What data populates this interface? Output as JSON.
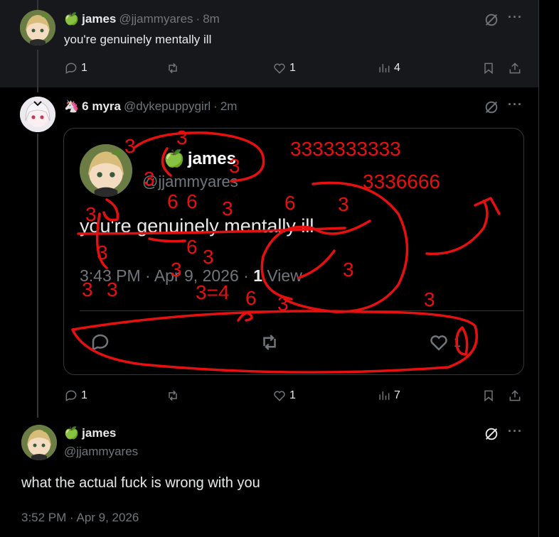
{
  "tweets": [
    {
      "emoji": "🍏",
      "name": "james",
      "handle": "@jjammyares",
      "sep": "·",
      "time": "8m",
      "text": "you're genuinely mentally ill",
      "replies": "1",
      "likes": "1",
      "views": "4"
    },
    {
      "emoji": "🦄",
      "name": "6 myra",
      "handle": "@dykepuppygirl",
      "sep": "·",
      "time": "2m",
      "replies": "1",
      "likes": "1",
      "views": "7",
      "image": {
        "emoji": "🍏",
        "name": "james",
        "handle": "@jjammyares",
        "text": "you're genuinely mentally ill",
        "meta_prefix": "3:43 PM · Apr 9, 2026 · ",
        "meta_views": "1",
        "meta_suffix": " View",
        "like_count": "1"
      }
    }
  ],
  "focus": {
    "emoji": "🍏",
    "name": "james",
    "handle": "@jjammyares",
    "text": "what the actual fuck is wrong with you",
    "meta": "3:52 PM · Apr 9, 2026"
  },
  "icons": {
    "more": "···",
    "reply": "reply-icon",
    "repost": "repost-icon",
    "like": "heart-icon",
    "views": "views-icon",
    "bookmark": "bookmark-icon",
    "share": "share-icon",
    "grok": "grok-icon"
  },
  "colors": {
    "background": "#000000",
    "highlight_bg": "#16181c",
    "text": "#e7e9ea",
    "muted": "#71767b",
    "border": "#2f3336",
    "scribble": "#e5100f"
  }
}
